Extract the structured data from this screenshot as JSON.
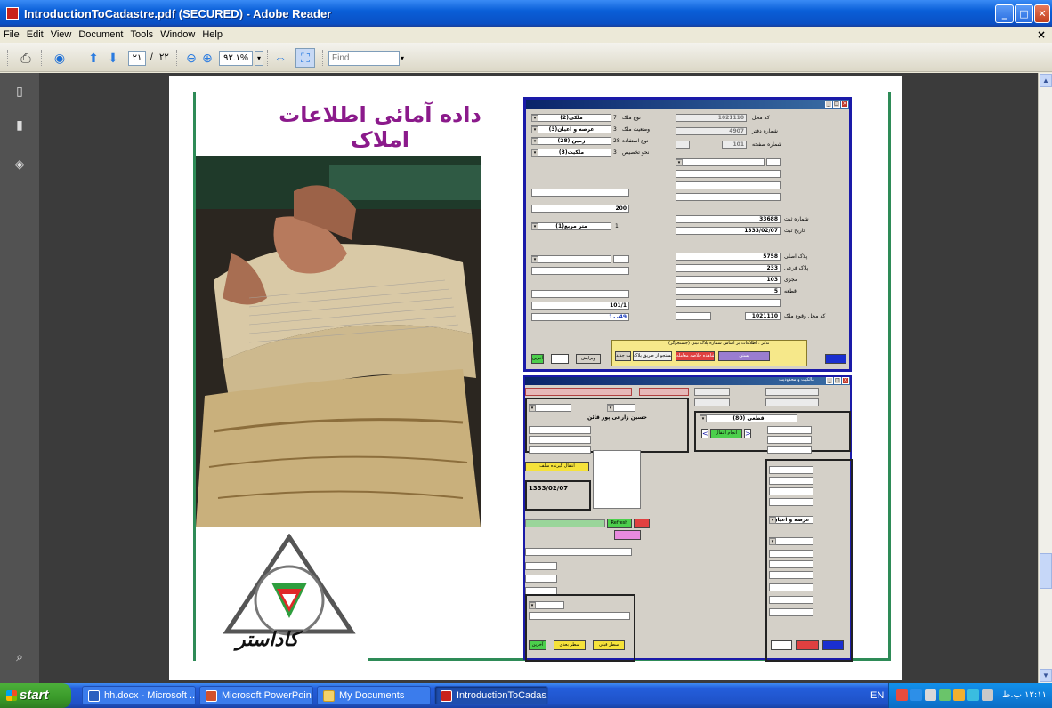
{
  "window": {
    "title": "IntroductionToCadastre.pdf (SECURED) - Adobe Reader"
  },
  "menu": [
    "File",
    "Edit",
    "View",
    "Document",
    "Tools",
    "Window",
    "Help"
  ],
  "toolbar": {
    "page_current": "٢١",
    "page_separator": "/",
    "page_total": "٢٢",
    "zoom": "٩٢.١%",
    "find_placeholder": "Find"
  },
  "slide": {
    "title": "داده آمائی اطلاعات املاک",
    "logo_text": "کاداستر"
  },
  "form1": {
    "fields_right": [
      {
        "label": "کد محل",
        "value": "1021110"
      },
      {
        "label": "شماره دفتر",
        "value": "4907"
      },
      {
        "label": "شماره صفحه",
        "value": "101"
      },
      {
        "label": "شماره ثبت",
        "value": "33688"
      },
      {
        "label": "تاریخ ثبت",
        "value": "1333/02/07"
      },
      {
        "label": "پلاک اصلی",
        "value": "5758"
      },
      {
        "label": "پلاک فرعی",
        "value": "233"
      },
      {
        "label": "مجزی",
        "value": "103"
      },
      {
        "label": "قطعه",
        "value": "5"
      },
      {
        "label": "کد محل وقوع ملک",
        "value": "1021110"
      }
    ],
    "fields_left": [
      {
        "label": "نوع ملک",
        "code": "7",
        "value": "ملکی(2)"
      },
      {
        "label": "وضعیت ملک",
        "code": "3",
        "value": "عرصه و اعیان(3)"
      },
      {
        "label": "نوع استفاده",
        "code": "28",
        "value": "زمین (28)"
      },
      {
        "label": "نحو تخصیص",
        "code": "3",
        "value": "ملکیت(3)"
      }
    ],
    "area_value": "200",
    "unit_code": "1",
    "unit_value": "متر مربع(1)",
    "ref_page": "101/1",
    "ref_book": "1٠٠49",
    "notice": "تذکر : اطلاعات بر اساس شماره پلاک ثبتی (جستجوگر)",
    "buttons": {
      "next": "آخرین",
      "search_plaque": "جستجو از طریق پلاک",
      "summary": "مشاهده خلاصه معامله",
      "exit": "بستن",
      "edit": "ویرایش",
      "new": "ثبت جدید"
    }
  },
  "form2": {
    "title": "مالکیت و محدودیت",
    "owner_name": "حسین زارعی پور قائن",
    "owner_share": "قطعی (80)",
    "reg_date": "1333/02/07",
    "transfer_type": "عرصه و اعیان",
    "buttons": {
      "transfer": "انتقال گیرنده سلف",
      "prev": "سطر قبلی",
      "next_row": "سطر بعدی",
      "last": "آخرین",
      "refresh": "Refresh",
      "done": "انجام انتقال"
    }
  },
  "taskbar": {
    "start": "start",
    "tasks": [
      "hh.docx - Microsoft ...",
      "Microsoft PowerPoint ...",
      "My Documents",
      "IntroductionToCadas..."
    ],
    "language": "EN",
    "clock": "١٢:١١ ب.ظ"
  },
  "colors": {
    "titlebar": "#0a5fd8",
    "taskbar": "#245edb",
    "start": "#3a9a2a",
    "slide_border": "#2e8b57",
    "title_purple": "#8b1a8b"
  }
}
